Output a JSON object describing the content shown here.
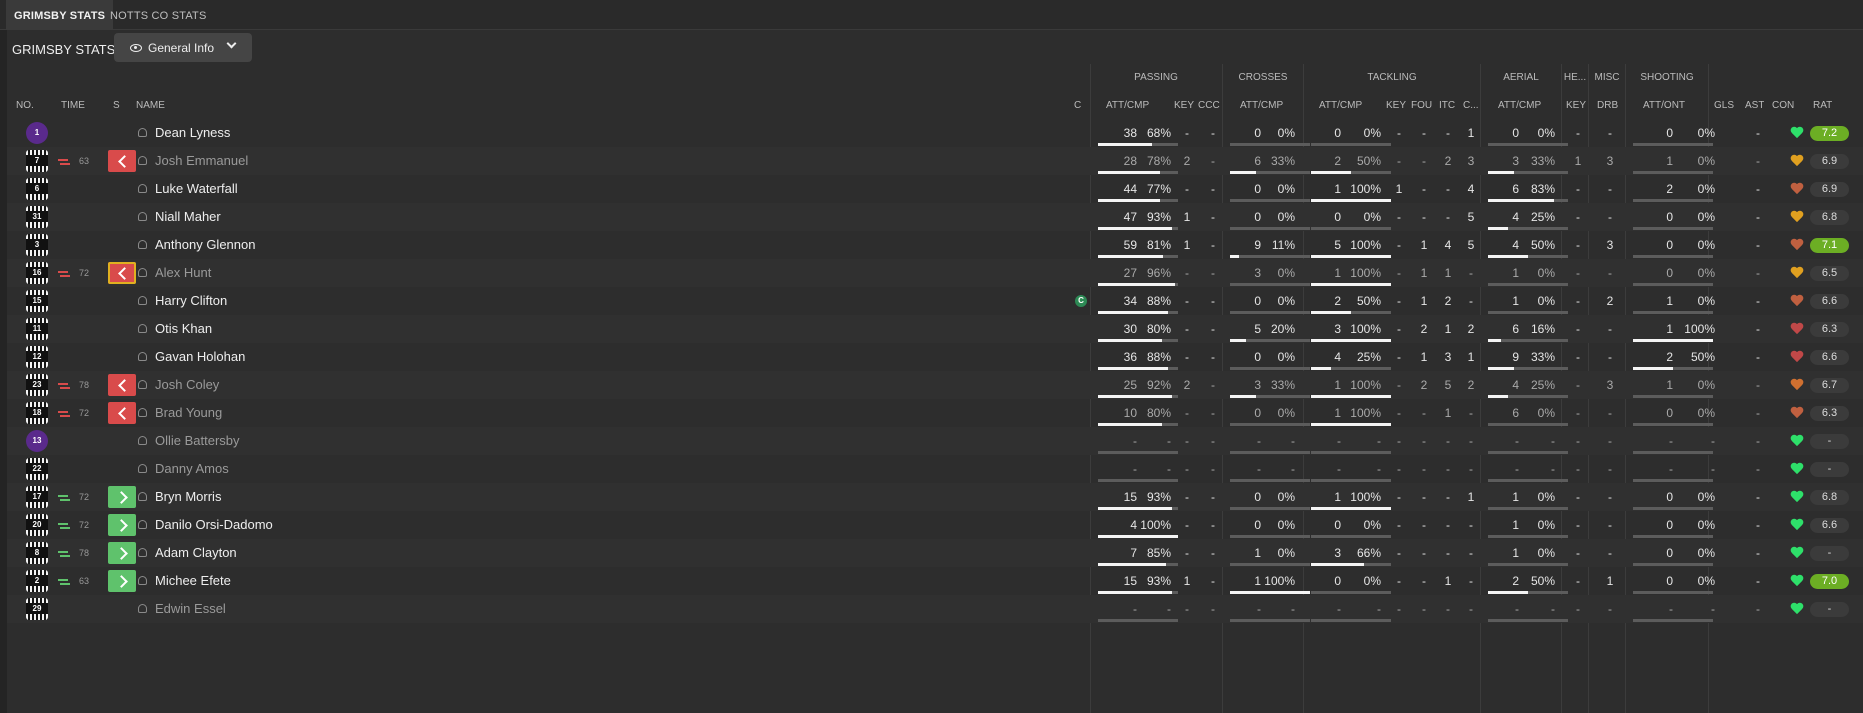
{
  "tabs": [
    {
      "label": "GRIMSBY STATS",
      "active": true
    },
    {
      "label": "NOTTS CO STATS",
      "active": false
    }
  ],
  "panel_title": "GRIMSBY STATS",
  "view_button": {
    "label": "General Info"
  },
  "groups": [
    "PASSING",
    "CROSSES",
    "TACKLING",
    "AERIAL",
    "HE...",
    "MISC",
    "SHOOTING"
  ],
  "headers": {
    "no": "NO.",
    "time": "TIME",
    "s": "S",
    "name": "NAME",
    "c": "C",
    "pass_attcmp": "ATT/CMP",
    "pass_key": "KEY",
    "pass_ccc": "CCC",
    "cross_attcmp": "ATT/CMP",
    "tack_attcmp": "ATT/CMP",
    "tack_key": "KEY",
    "tack_fou": "FOU",
    "tack_itc": "ITC",
    "tack_c": "C...",
    "aer_attcmp": "ATT/CMP",
    "he_key": "KEY",
    "misc_drb": "DRB",
    "shoot_attont": "ATT/ONT",
    "gls": "GLS",
    "ast": "AST",
    "con": "CON",
    "rat": "RAT"
  },
  "players": [
    {
      "no": "1",
      "gk": true,
      "sub": "",
      "time": "",
      "name": "Dean Lyness",
      "dim": false,
      "cap": "",
      "pa": "38",
      "pp": "68%",
      "pk": "-",
      "pc": "-",
      "ca": "0",
      "cp": "0%",
      "ta": "0",
      "tp": "0%",
      "tk": "-",
      "tf": "-",
      "ti": "-",
      "tc": "1",
      "aa": "0",
      "ap": "0%",
      "hk": "-",
      "md": "-",
      "sa": "0",
      "sp": "0%",
      "gls": "",
      "ast": "-",
      "con": "#2ee06a",
      "rat": "7.2",
      "hi": true,
      "bp": 0.68,
      "bc": 0,
      "bt": 0,
      "ba": 0,
      "bs": 0
    },
    {
      "no": "7",
      "gk": false,
      "sub": "off",
      "time": "63",
      "name": "Josh Emmanuel",
      "dim": true,
      "cap": "",
      "pa": "28",
      "pp": "78%",
      "pk": "2",
      "pc": "-",
      "ca": "6",
      "cp": "33%",
      "ta": "2",
      "tp": "50%",
      "tk": "-",
      "tf": "-",
      "ti": "2",
      "tc": "3",
      "aa": "3",
      "ap": "33%",
      "hk": "1",
      "md": "3",
      "sa": "1",
      "sp": "0%",
      "gls": "",
      "ast": "-",
      "con": "#e0a020",
      "rat": "6.9",
      "hi": false,
      "bp": 0.78,
      "bc": 0.33,
      "bt": 0.5,
      "ba": 0.33,
      "bs": 0
    },
    {
      "no": "6",
      "gk": false,
      "sub": "",
      "time": "",
      "name": "Luke Waterfall",
      "dim": false,
      "cap": "",
      "pa": "44",
      "pp": "77%",
      "pk": "-",
      "pc": "-",
      "ca": "0",
      "cp": "0%",
      "ta": "1",
      "tp": "100%",
      "tk": "1",
      "tf": "-",
      "ti": "-",
      "tc": "4",
      "aa": "6",
      "ap": "83%",
      "hk": "-",
      "md": "-",
      "sa": "2",
      "sp": "0%",
      "gls": "",
      "ast": "-",
      "con": "#c06040",
      "rat": "6.9",
      "hi": false,
      "bp": 0.77,
      "bc": 0,
      "bt": 1,
      "ba": 0.83,
      "bs": 0
    },
    {
      "no": "31",
      "gk": false,
      "sub": "",
      "time": "",
      "name": "Niall Maher",
      "dim": false,
      "cap": "",
      "pa": "47",
      "pp": "93%",
      "pk": "1",
      "pc": "-",
      "ca": "0",
      "cp": "0%",
      "ta": "0",
      "tp": "0%",
      "tk": "-",
      "tf": "-",
      "ti": "-",
      "tc": "5",
      "aa": "4",
      "ap": "25%",
      "hk": "-",
      "md": "-",
      "sa": "0",
      "sp": "0%",
      "gls": "",
      "ast": "-",
      "con": "#e0a020",
      "rat": "6.8",
      "hi": false,
      "bp": 0.93,
      "bc": 0,
      "bt": 0,
      "ba": 0.25,
      "bs": 0
    },
    {
      "no": "3",
      "gk": false,
      "sub": "",
      "time": "",
      "name": "Anthony Glennon",
      "dim": false,
      "cap": "",
      "pa": "59",
      "pp": "81%",
      "pk": "1",
      "pc": "-",
      "ca": "9",
      "cp": "11%",
      "ta": "5",
      "tp": "100%",
      "tk": "-",
      "tf": "1",
      "ti": "4",
      "tc": "5",
      "aa": "4",
      "ap": "50%",
      "hk": "-",
      "md": "3",
      "sa": "0",
      "sp": "0%",
      "gls": "",
      "ast": "-",
      "con": "#c06040",
      "rat": "7.1",
      "hi": true,
      "bp": 0.81,
      "bc": 0.11,
      "bt": 1,
      "ba": 0.5,
      "bs": 0
    },
    {
      "no": "16",
      "gk": false,
      "sub": "off",
      "time": "72",
      "name": "Alex Hunt",
      "dim": true,
      "cap": "",
      "pa": "27",
      "pp": "96%",
      "pk": "-",
      "pc": "-",
      "ca": "3",
      "cp": "0%",
      "ta": "1",
      "tp": "100%",
      "tk": "-",
      "tf": "1",
      "ti": "1",
      "tc": "-",
      "aa": "1",
      "ap": "0%",
      "hk": "-",
      "md": "-",
      "sa": "0",
      "sp": "0%",
      "gls": "",
      "ast": "-",
      "con": "#e0a020",
      "rat": "6.5",
      "hi": false,
      "bp": 0.96,
      "bc": 0,
      "bt": 1,
      "ba": 0,
      "bs": 0,
      "cursor": true
    },
    {
      "no": "15",
      "gk": false,
      "sub": "",
      "time": "",
      "name": "Harry Clifton",
      "dim": false,
      "cap": "C",
      "pa": "34",
      "pp": "88%",
      "pk": "-",
      "pc": "-",
      "ca": "0",
      "cp": "0%",
      "ta": "2",
      "tp": "50%",
      "tk": "-",
      "tf": "1",
      "ti": "2",
      "tc": "-",
      "aa": "1",
      "ap": "0%",
      "hk": "-",
      "md": "2",
      "sa": "1",
      "sp": "0%",
      "gls": "",
      "ast": "-",
      "con": "#c06040",
      "rat": "6.6",
      "hi": false,
      "bp": 0.88,
      "bc": 0,
      "bt": 0.5,
      "ba": 0,
      "bs": 0
    },
    {
      "no": "11",
      "gk": false,
      "sub": "",
      "time": "",
      "name": "Otis Khan",
      "dim": false,
      "cap": "",
      "pa": "30",
      "pp": "80%",
      "pk": "-",
      "pc": "-",
      "ca": "5",
      "cp": "20%",
      "ta": "3",
      "tp": "100%",
      "tk": "-",
      "tf": "2",
      "ti": "1",
      "tc": "2",
      "aa": "6",
      "ap": "16%",
      "hk": "-",
      "md": "-",
      "sa": "1",
      "sp": "100%",
      "gls": "",
      "ast": "-",
      "con": "#c04848",
      "rat": "6.3",
      "hi": false,
      "bp": 0.8,
      "bc": 0.2,
      "bt": 1,
      "ba": 0.16,
      "bs": 1
    },
    {
      "no": "12",
      "gk": false,
      "sub": "",
      "time": "",
      "name": "Gavan Holohan",
      "dim": false,
      "cap": "",
      "pa": "36",
      "pp": "88%",
      "pk": "-",
      "pc": "-",
      "ca": "0",
      "cp": "0%",
      "ta": "4",
      "tp": "25%",
      "tk": "-",
      "tf": "1",
      "ti": "3",
      "tc": "1",
      "aa": "9",
      "ap": "33%",
      "hk": "-",
      "md": "-",
      "sa": "2",
      "sp": "50%",
      "gls": "",
      "ast": "-",
      "con": "#c04848",
      "rat": "6.6",
      "hi": false,
      "bp": 0.88,
      "bc": 0,
      "bt": 0.25,
      "ba": 0.33,
      "bs": 0.5
    },
    {
      "no": "23",
      "gk": false,
      "sub": "off",
      "time": "78",
      "name": "Josh Coley",
      "dim": true,
      "cap": "",
      "pa": "25",
      "pp": "92%",
      "pk": "2",
      "pc": "-",
      "ca": "3",
      "cp": "33%",
      "ta": "1",
      "tp": "100%",
      "tk": "-",
      "tf": "2",
      "ti": "5",
      "tc": "2",
      "aa": "4",
      "ap": "25%",
      "hk": "-",
      "md": "3",
      "sa": "1",
      "sp": "0%",
      "gls": "",
      "ast": "-",
      "con": "#d07030",
      "rat": "6.7",
      "hi": false,
      "bp": 0.92,
      "bc": 0.33,
      "bt": 1,
      "ba": 0.25,
      "bs": 0
    },
    {
      "no": "18",
      "gk": false,
      "sub": "off",
      "time": "72",
      "name": "Brad Young",
      "dim": true,
      "cap": "",
      "pa": "10",
      "pp": "80%",
      "pk": "-",
      "pc": "-",
      "ca": "0",
      "cp": "0%",
      "ta": "1",
      "tp": "100%",
      "tk": "-",
      "tf": "-",
      "ti": "1",
      "tc": "-",
      "aa": "6",
      "ap": "0%",
      "hk": "-",
      "md": "-",
      "sa": "0",
      "sp": "0%",
      "gls": "",
      "ast": "-",
      "con": "#c06040",
      "rat": "6.3",
      "hi": false,
      "bp": 0.8,
      "bc": 0,
      "bt": 1,
      "ba": 0,
      "bs": 0
    },
    {
      "no": "13",
      "gk": true,
      "sub": "",
      "time": "",
      "name": "Ollie Battersby",
      "dim": true,
      "cap": "",
      "pa": "-",
      "pp": "-",
      "pk": "-",
      "pc": "-",
      "ca": "-",
      "cp": "-",
      "ta": "-",
      "tp": "-",
      "tk": "-",
      "tf": "-",
      "ti": "-",
      "tc": "-",
      "aa": "-",
      "ap": "-",
      "hk": "-",
      "md": "-",
      "sa": "-",
      "sp": "-",
      "gls": "",
      "ast": "-",
      "con": "#2ee06a",
      "rat": "-",
      "hi": false,
      "bp": 0,
      "bc": 0,
      "bt": 0,
      "ba": 0,
      "bs": 0
    },
    {
      "no": "22",
      "gk": false,
      "sub": "",
      "time": "",
      "name": "Danny Amos",
      "dim": true,
      "cap": "",
      "pa": "-",
      "pp": "-",
      "pk": "-",
      "pc": "-",
      "ca": "-",
      "cp": "-",
      "ta": "-",
      "tp": "-",
      "tk": "-",
      "tf": "-",
      "ti": "-",
      "tc": "-",
      "aa": "-",
      "ap": "-",
      "hk": "-",
      "md": "-",
      "sa": "-",
      "sp": "-",
      "gls": "",
      "ast": "-",
      "con": "#2ee06a",
      "rat": "-",
      "hi": false,
      "bp": 0,
      "bc": 0,
      "bt": 0,
      "ba": 0,
      "bs": 0
    },
    {
      "no": "17",
      "gk": false,
      "sub": "on",
      "time": "72",
      "name": "Bryn Morris",
      "dim": false,
      "cap": "",
      "pa": "15",
      "pp": "93%",
      "pk": "-",
      "pc": "-",
      "ca": "0",
      "cp": "0%",
      "ta": "1",
      "tp": "100%",
      "tk": "-",
      "tf": "-",
      "ti": "-",
      "tc": "1",
      "aa": "1",
      "ap": "0%",
      "hk": "-",
      "md": "-",
      "sa": "0",
      "sp": "0%",
      "gls": "",
      "ast": "-",
      "con": "#2ee06a",
      "rat": "6.8",
      "hi": false,
      "bp": 0.93,
      "bc": 0,
      "bt": 1,
      "ba": 0,
      "bs": 0
    },
    {
      "no": "20",
      "gk": false,
      "sub": "on",
      "time": "72",
      "name": "Danilo Orsi-Dadomo",
      "dim": false,
      "cap": "",
      "pa": "4",
      "pp": "100%",
      "pk": "-",
      "pc": "-",
      "ca": "0",
      "cp": "0%",
      "ta": "0",
      "tp": "0%",
      "tk": "-",
      "tf": "-",
      "ti": "-",
      "tc": "-",
      "aa": "1",
      "ap": "0%",
      "hk": "-",
      "md": "-",
      "sa": "0",
      "sp": "0%",
      "gls": "",
      "ast": "-",
      "con": "#2ee06a",
      "rat": "6.6",
      "hi": false,
      "bp": 1,
      "bc": 0,
      "bt": 0,
      "ba": 0,
      "bs": 0
    },
    {
      "no": "8",
      "gk": false,
      "sub": "on",
      "time": "78",
      "name": "Adam Clayton",
      "dim": false,
      "cap": "",
      "pa": "7",
      "pp": "85%",
      "pk": "-",
      "pc": "-",
      "ca": "1",
      "cp": "0%",
      "ta": "3",
      "tp": "66%",
      "tk": "-",
      "tf": "-",
      "ti": "-",
      "tc": "-",
      "aa": "1",
      "ap": "0%",
      "hk": "-",
      "md": "-",
      "sa": "0",
      "sp": "0%",
      "gls": "",
      "ast": "-",
      "con": "#2ee06a",
      "rat": "-",
      "hi": false,
      "bp": 0.85,
      "bc": 0,
      "bt": 0.66,
      "ba": 0,
      "bs": 0
    },
    {
      "no": "2",
      "gk": false,
      "sub": "on",
      "time": "63",
      "name": "Michee Efete",
      "dim": false,
      "cap": "",
      "pa": "15",
      "pp": "93%",
      "pk": "1",
      "pc": "-",
      "ca": "1",
      "cp": "100%",
      "ta": "0",
      "tp": "0%",
      "tk": "-",
      "tf": "-",
      "ti": "1",
      "tc": "-",
      "aa": "2",
      "ap": "50%",
      "hk": "-",
      "md": "1",
      "sa": "0",
      "sp": "0%",
      "gls": "",
      "ast": "-",
      "con": "#2ee06a",
      "rat": "7.0",
      "hi": true,
      "bp": 0.93,
      "bc": 1,
      "bt": 0,
      "ba": 0.5,
      "bs": 0
    },
    {
      "no": "29",
      "gk": false,
      "sub": "",
      "time": "",
      "name": "Edwin Essel",
      "dim": true,
      "cap": "",
      "pa": "-",
      "pp": "-",
      "pk": "-",
      "pc": "-",
      "ca": "-",
      "cp": "-",
      "ta": "-",
      "tp": "-",
      "tk": "-",
      "tf": "-",
      "ti": "-",
      "tc": "-",
      "aa": "-",
      "ap": "-",
      "hk": "-",
      "md": "-",
      "sa": "-",
      "sp": "-",
      "gls": "",
      "ast": "-",
      "con": "#2ee06a",
      "rat": "-",
      "hi": false,
      "bp": 0,
      "bc": 0,
      "bt": 0,
      "ba": 0,
      "bs": 0
    }
  ]
}
